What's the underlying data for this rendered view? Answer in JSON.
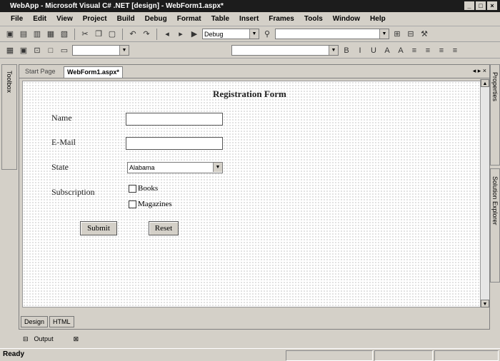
{
  "window": {
    "title": "WebApp - Microsoft Visual C# .NET [design] - WebForm1.aspx*",
    "controls": [
      "_",
      "□",
      "×"
    ]
  },
  "menu": [
    "File",
    "Edit",
    "View",
    "Project",
    "Build",
    "Debug",
    "Format",
    "Table",
    "Insert",
    "Frames",
    "Tools",
    "Window",
    "Help"
  ],
  "toolbar": {
    "config_value": "Debug"
  },
  "tabs": {
    "start_page": "Start Page",
    "active": "WebForm1.aspx*"
  },
  "left_panel": {
    "toolbox_label": "Toolbox"
  },
  "right_panel": {
    "properties_label": "Properties",
    "solution_label": "Solution Explorer"
  },
  "form": {
    "title": "Registration Form",
    "name_label": "Name",
    "email_label": "E-Mail",
    "state_label": "State",
    "state_value": "Alabama",
    "subscription_label": "Subscription",
    "options": [
      "Books",
      "Magazines"
    ],
    "submit_label": "Submit",
    "reset_label": "Reset"
  },
  "view_tabs": [
    "Design",
    "HTML"
  ],
  "output": {
    "label": "Output"
  },
  "status": {
    "text": "Ready"
  }
}
